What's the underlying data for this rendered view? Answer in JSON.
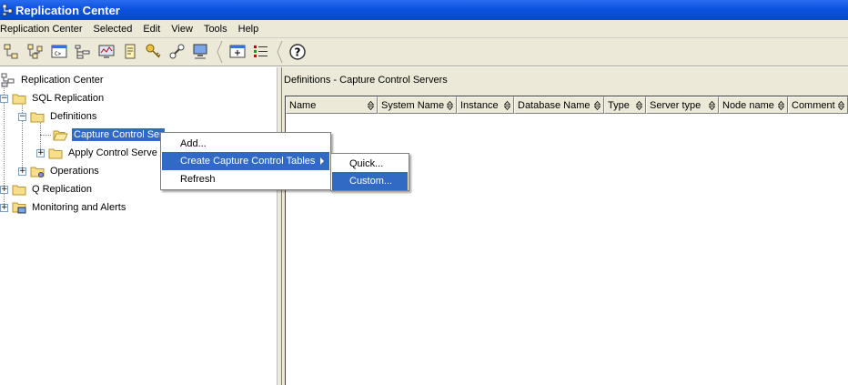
{
  "window": {
    "title": "Replication Center"
  },
  "menubar": {
    "items": [
      "Replication Center",
      "Selected",
      "Edit",
      "View",
      "Tools",
      "Help"
    ]
  },
  "toolbar": {
    "buttons": [
      "tree-icon",
      "tree-branch-icon",
      "command-window-icon",
      "hierarchy-icon",
      "monitor-icon",
      "notepad-icon",
      "key-icon",
      "wrench-icon",
      "computer-icon",
      "add-window-icon",
      "task-list-icon",
      "help-icon"
    ]
  },
  "tree": {
    "root": "Replication Center",
    "sql_replication": "SQL Replication",
    "definitions": "Definitions",
    "capture_control": "Capture Control Ser",
    "apply_control": "Apply Control Serve",
    "operations": "Operations",
    "q_replication": "Q Replication",
    "monitoring": "Monitoring and Alerts"
  },
  "right_panel": {
    "header": "Definitions - Capture Control Servers",
    "columns": [
      "Name",
      "System Name",
      "Instance",
      "Database Name",
      "Type",
      "Server type",
      "Node name",
      "Comment"
    ]
  },
  "context_menu": {
    "items": [
      "Add...",
      "Create Capture Control Tables",
      "Refresh"
    ],
    "active_index": 1
  },
  "submenu": {
    "items": [
      "Quick...",
      "Custom..."
    ],
    "active_index": 1
  },
  "colors": {
    "title_bar": "#0b52e0",
    "selection": "#316ac5",
    "chrome": "#ece9d8"
  }
}
